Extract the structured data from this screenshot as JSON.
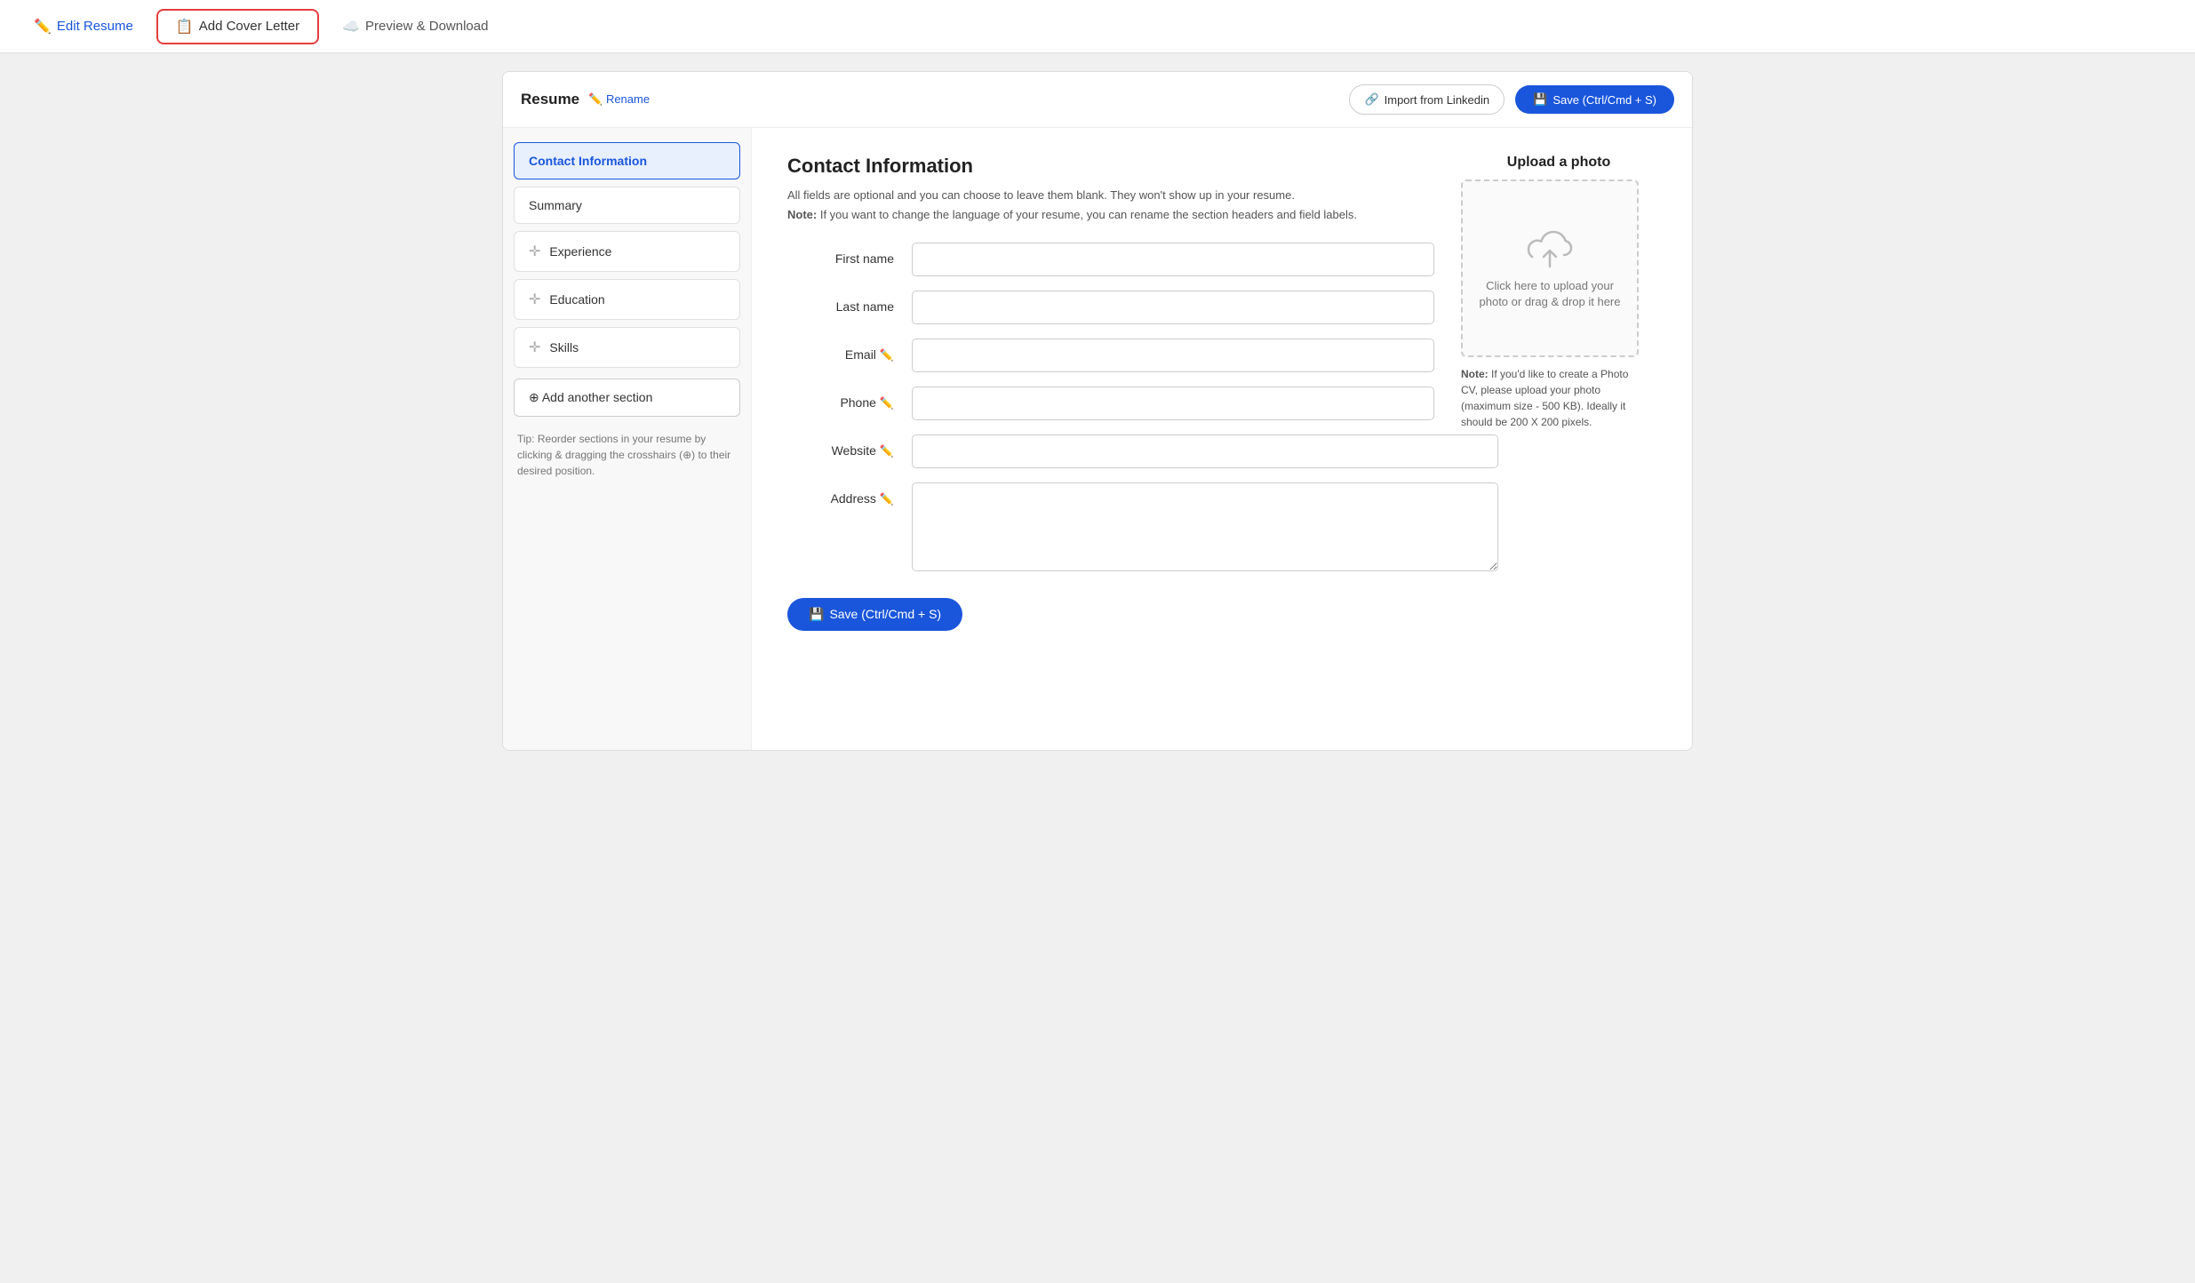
{
  "topNav": {
    "tabs": [
      {
        "id": "edit-resume",
        "label": "Edit Resume",
        "icon": "✏️",
        "active": false,
        "highlighted": false
      },
      {
        "id": "add-cover-letter",
        "label": "Add Cover Letter",
        "icon": "📋",
        "active": false,
        "highlighted": true
      },
      {
        "id": "preview-download",
        "label": "Preview & Download",
        "icon": "☁️",
        "active": false,
        "highlighted": false
      }
    ]
  },
  "resumeHeader": {
    "title": "Resume",
    "renameLabel": "✏️ Rename",
    "importBtn": "Import from Linkedin",
    "saveBtn": "Save (Ctrl/Cmd + S)"
  },
  "sidebar": {
    "items": [
      {
        "id": "contact-information",
        "label": "Contact Information",
        "active": true,
        "draggable": false
      },
      {
        "id": "summary",
        "label": "Summary",
        "active": false,
        "draggable": false
      },
      {
        "id": "experience",
        "label": "Experience",
        "active": false,
        "draggable": true
      },
      {
        "id": "education",
        "label": "Education",
        "active": false,
        "draggable": true
      },
      {
        "id": "skills",
        "label": "Skills",
        "active": false,
        "draggable": true
      }
    ],
    "addSectionLabel": "⊕ Add another section",
    "tip": "Tip: Reorder sections in your resume by clicking & dragging the crosshairs (⊕) to their desired position."
  },
  "contactInfo": {
    "sectionTitle": "Contact Information",
    "desc": "All fields are optional and you can choose to leave them blank. They won't show up in your resume.",
    "note": "Note: If you want to change the language of your resume, you can rename the section headers and field labels.",
    "fields": [
      {
        "id": "first-name",
        "label": "First name",
        "type": "input",
        "hasIcon": false
      },
      {
        "id": "last-name",
        "label": "Last name",
        "type": "input",
        "hasIcon": false
      },
      {
        "id": "email",
        "label": "Email ✏️",
        "type": "input",
        "hasIcon": true
      },
      {
        "id": "phone",
        "label": "Phone ✏️",
        "type": "input",
        "hasIcon": true
      },
      {
        "id": "website",
        "label": "Website ✏️",
        "type": "input",
        "hasIcon": true
      },
      {
        "id": "address",
        "label": "Address ✏️",
        "type": "textarea",
        "hasIcon": true
      }
    ],
    "saveBtn": "Save (Ctrl/Cmd + S)"
  },
  "photoUpload": {
    "title": "Upload a photo",
    "uploadText": "Click here to upload your photo or drag & drop it here",
    "note": "Note: If you'd like to create a Photo CV, please upload your photo (maximum size - 500 KB). Ideally it should be 200 X 200 pixels."
  }
}
